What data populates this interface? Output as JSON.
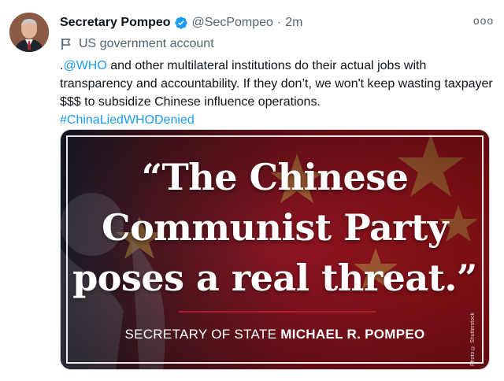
{
  "author": {
    "name": "Secretary Pompeo",
    "handle": "@SecPompeo",
    "separator": "·",
    "timestamp": "2m",
    "verified_icon": "verified-badge-icon",
    "label": "US government account",
    "label_icon": "flag-icon"
  },
  "more_menu": {
    "label": "ooo",
    "icon": "more-options-icon"
  },
  "tweet": {
    "mention": "@WHO",
    "text_lead": ".",
    "text_body": " and other multilateral institutions do their actual jobs with transparency and accountability. If they don’t, we won't keep wasting taxpayer $$$ to subsidize Chinese influence operations.",
    "hashtag": "#ChinaLiedWHODenied"
  },
  "media": {
    "quote_line1": "“The Chinese",
    "quote_line2": "Communist Party",
    "quote_line3": "poses a real threat.”",
    "attribution_prefix": "SECRETARY OF STATE ",
    "attribution_name": "MICHAEL R. POMPEO",
    "photo_credit": "Photo © Shutterstock"
  },
  "colors": {
    "link": "#1d9bf0",
    "verified": "#1d9bf0",
    "muted": "#536471",
    "rule": "#b01d2a"
  }
}
